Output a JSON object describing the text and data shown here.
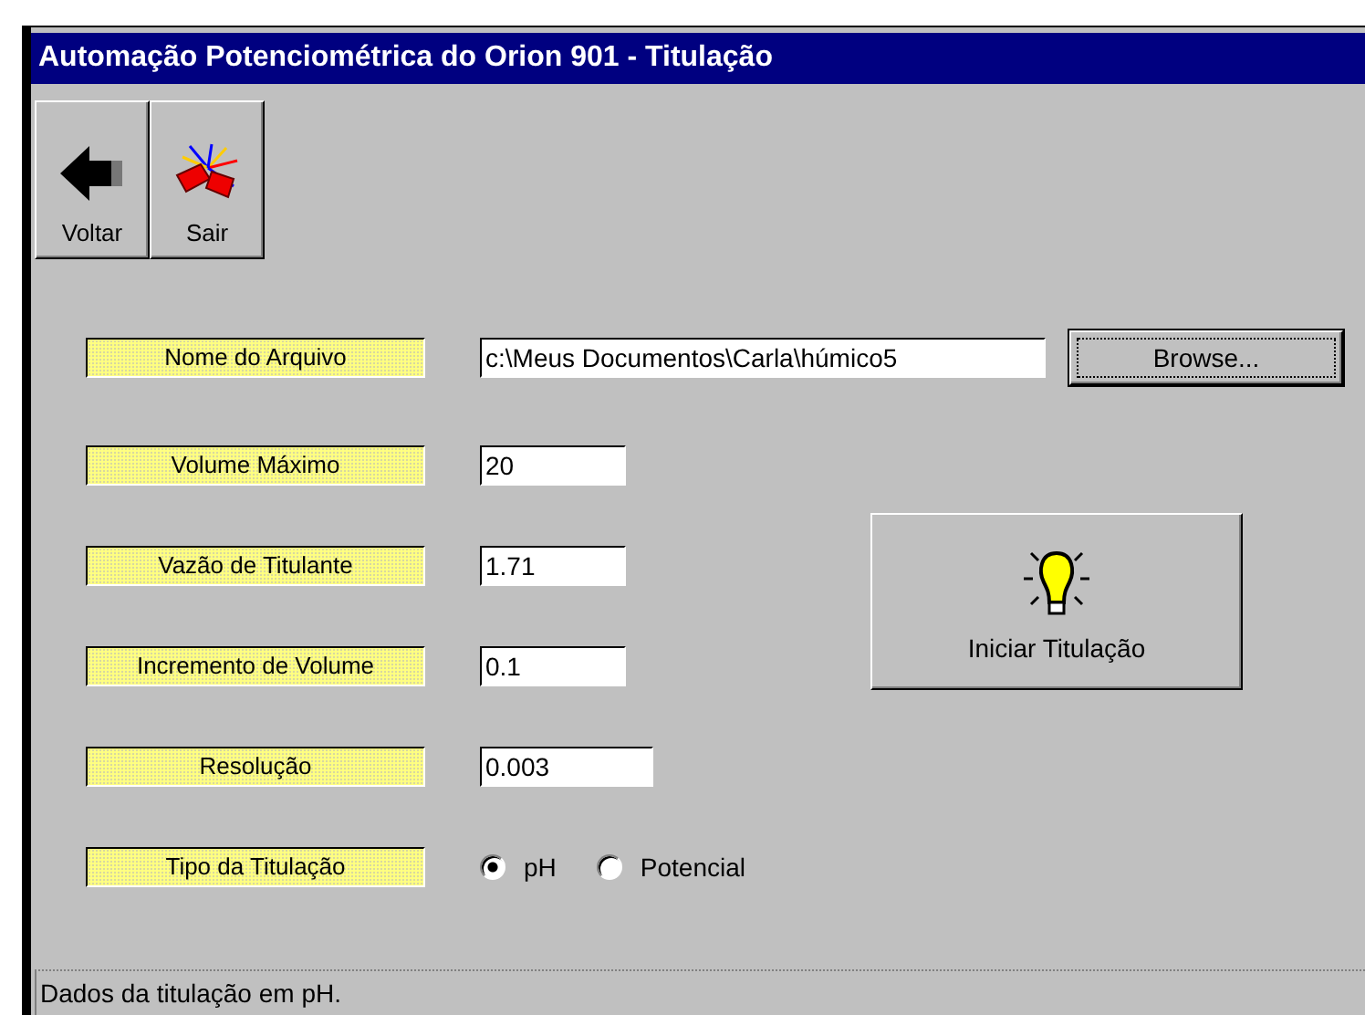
{
  "window": {
    "title": "Automação Potenciométrica do Orion 901 - Titulação"
  },
  "toolbar": [
    {
      "label": "Voltar",
      "kind": "back"
    },
    {
      "label": "Sair",
      "kind": "exit"
    }
  ],
  "fields": [
    {
      "label": "Nome do Arquivo",
      "value": "c:\\Meus Documentos\\Carla\\húmico5",
      "kind": "file"
    },
    {
      "label": "Volume Máximo",
      "value": "20",
      "kind": "short"
    },
    {
      "label": "Vazão de Titulante",
      "value": "1.71",
      "kind": "short"
    },
    {
      "label": "Incremento de Volume",
      "value": "0.1",
      "kind": "short"
    },
    {
      "label": "Resolução",
      "value": "0.003",
      "kind": "medium"
    }
  ],
  "browse_button": "Browse...",
  "start_button": "Iniciar Titulação",
  "titration_type": {
    "label": "Tipo da Titulação",
    "options": [
      {
        "label": "pH",
        "selected": true
      },
      {
        "label": "Potencial",
        "selected": false
      }
    ]
  },
  "status_bar": "Dados da titulação em pH."
}
